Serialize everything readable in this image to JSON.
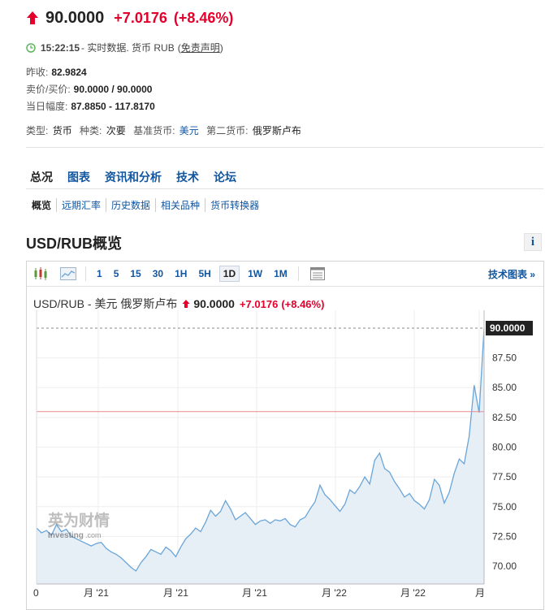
{
  "header": {
    "price": "90.0000",
    "change": "+7.0176",
    "change_pct": "(+8.46%)",
    "time": "15:22:15",
    "meta_text": "- 实时数据.  货币 RUB",
    "disclaimer_open": "(",
    "disclaimer": "免责声明",
    "disclaimer_close": ")"
  },
  "stats": [
    {
      "label": "昨收:",
      "value": "82.9824"
    },
    {
      "label": "卖价/买价:",
      "value": "90.0000 / 90.0000"
    },
    {
      "label": "当日幅度:",
      "value": "87.8850 - 117.8170"
    }
  ],
  "types": {
    "type_label": "类型:",
    "type_value": "货币",
    "kind_label": "种类:",
    "kind_value": "次要",
    "base_label": "基准货币:",
    "base_value": "美元",
    "second_label": "第二货币:",
    "second_value": "俄罗斯卢布"
  },
  "tabs": [
    "总况",
    "图表",
    "资讯和分析",
    "技术",
    "论坛"
  ],
  "subtabs": [
    "概览",
    "远期汇率",
    "历史数据",
    "相关品种",
    "货币转换器"
  ],
  "overview_title": "USD/RUB概览",
  "info_icon": "i",
  "chart": {
    "periods": [
      "1",
      "5",
      "15",
      "30",
      "1H",
      "5H",
      "1D",
      "1W",
      "1M"
    ],
    "active_period": "1D",
    "tech_link": "技术图表 »",
    "title": "USD/RUB - 美元 俄罗斯卢布",
    "price": "90.0000",
    "change": "+7.0176",
    "change_pct": "(+8.46%)",
    "watermark_cn": "英为财情",
    "watermark_en": "Investing",
    "watermark_suffix": ".com",
    "last_label": "90.0000",
    "colors": {
      "line": "#6aa5d8",
      "fill": "#e6eef6",
      "prev_close": "#e88b8b",
      "accent_red": "#e4002b",
      "link": "#1256a0"
    }
  },
  "chart_data": {
    "type": "area",
    "title": "USD/RUB - 美元 俄罗斯卢布",
    "ylim": [
      68.5,
      91.5
    ],
    "yticks": [
      70.0,
      72.5,
      75.0,
      77.5,
      80.0,
      82.5,
      85.0,
      87.5
    ],
    "xtick_labels": [
      "0",
      "月 '21",
      "月 '21",
      "月 '21",
      "月 '22",
      "月 '22",
      "月"
    ],
    "prev_close": 82.9824,
    "last": 90.0,
    "values": [
      73.2,
      72.8,
      73.0,
      72.6,
      73.5,
      72.9,
      73.1,
      72.5,
      72.3,
      72.1,
      71.9,
      71.7,
      71.9,
      72.0,
      71.5,
      71.2,
      71.0,
      70.7,
      70.3,
      69.9,
      69.6,
      70.3,
      70.8,
      71.4,
      71.2,
      71.0,
      71.6,
      71.3,
      70.8,
      71.6,
      72.3,
      72.7,
      73.2,
      72.9,
      73.7,
      74.7,
      74.2,
      74.6,
      75.5,
      74.8,
      73.9,
      74.2,
      74.5,
      74.0,
      73.5,
      73.8,
      73.9,
      73.6,
      73.9,
      73.8,
      74.0,
      73.5,
      73.3,
      73.9,
      74.1,
      74.8,
      75.4,
      76.8,
      76.0,
      75.6,
      75.1,
      74.6,
      75.2,
      76.4,
      76.1,
      76.7,
      77.5,
      76.9,
      78.9,
      79.5,
      78.2,
      77.9,
      77.1,
      76.5,
      75.8,
      76.1,
      75.5,
      75.2,
      74.8,
      75.6,
      77.3,
      76.8,
      75.3,
      76.2,
      77.8,
      79.0,
      78.6,
      80.9,
      85.2,
      82.9,
      90.0
    ]
  }
}
